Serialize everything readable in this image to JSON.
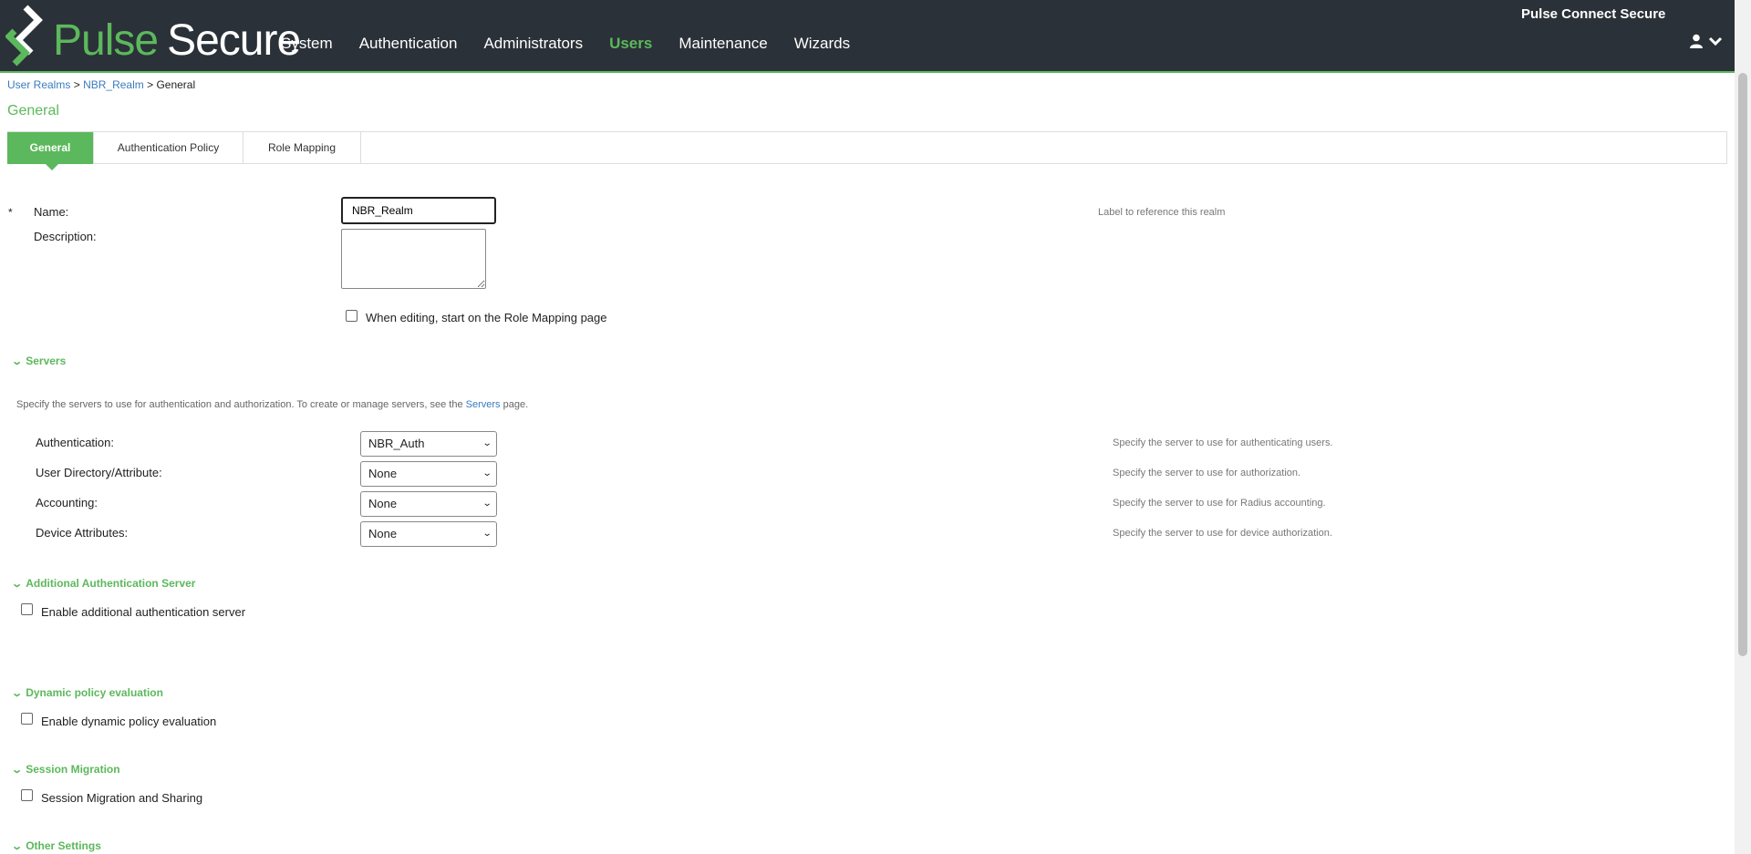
{
  "header": {
    "logo": {
      "pulse": "Pulse",
      "secure": "Secure"
    },
    "nav": [
      "System",
      "Authentication",
      "Administrators",
      "Users",
      "Maintenance",
      "Wizards"
    ],
    "active_nav": "Users",
    "product_name": "Pulse Connect Secure",
    "user_icon": "user-icon"
  },
  "breadcrumb": {
    "items": [
      "User Realms",
      "NBR_Realm",
      "General"
    ],
    "separator": ">"
  },
  "page_title": "General",
  "tabs": [
    "General",
    "Authentication Policy",
    "Role Mapping"
  ],
  "active_tab": "General",
  "form": {
    "required_mark": "*",
    "name_label": "Name:",
    "name_value": "NBR_Realm",
    "name_hint": "Label to reference this realm",
    "description_label": "Description:",
    "description_value": "",
    "role_mapping_checkbox": "When editing, start on the Role Mapping page"
  },
  "servers": {
    "title": "Servers",
    "intro_pre": "Specify the servers to use for authentication and authorization. To create or manage servers, see the",
    "intro_link": "Servers",
    "intro_post": "page.",
    "rows": [
      {
        "label": "Authentication:",
        "value": "NBR_Auth",
        "hint": "Specify the server to use for authenticating users."
      },
      {
        "label": "User Directory/Attribute:",
        "value": "None",
        "hint": "Specify the server to use for authorization."
      },
      {
        "label": "Accounting:",
        "value": "None",
        "hint": "Specify the server to use for Radius accounting."
      },
      {
        "label": "Device Attributes:",
        "value": "None",
        "hint": "Specify the server to use for device authorization."
      }
    ]
  },
  "additional_auth": {
    "title": "Additional Authentication Server",
    "checkbox": "Enable additional authentication server"
  },
  "dynamic_policy": {
    "title": "Dynamic policy evaluation",
    "checkbox": "Enable dynamic policy evaluation"
  },
  "session_migration": {
    "title": "Session Migration",
    "checkbox": "Session Migration and Sharing"
  },
  "other_settings": {
    "title": "Other Settings"
  },
  "colors": {
    "header_bg": "#2b3138",
    "accent": "#5cb85c",
    "link": "#3a7bbf"
  }
}
